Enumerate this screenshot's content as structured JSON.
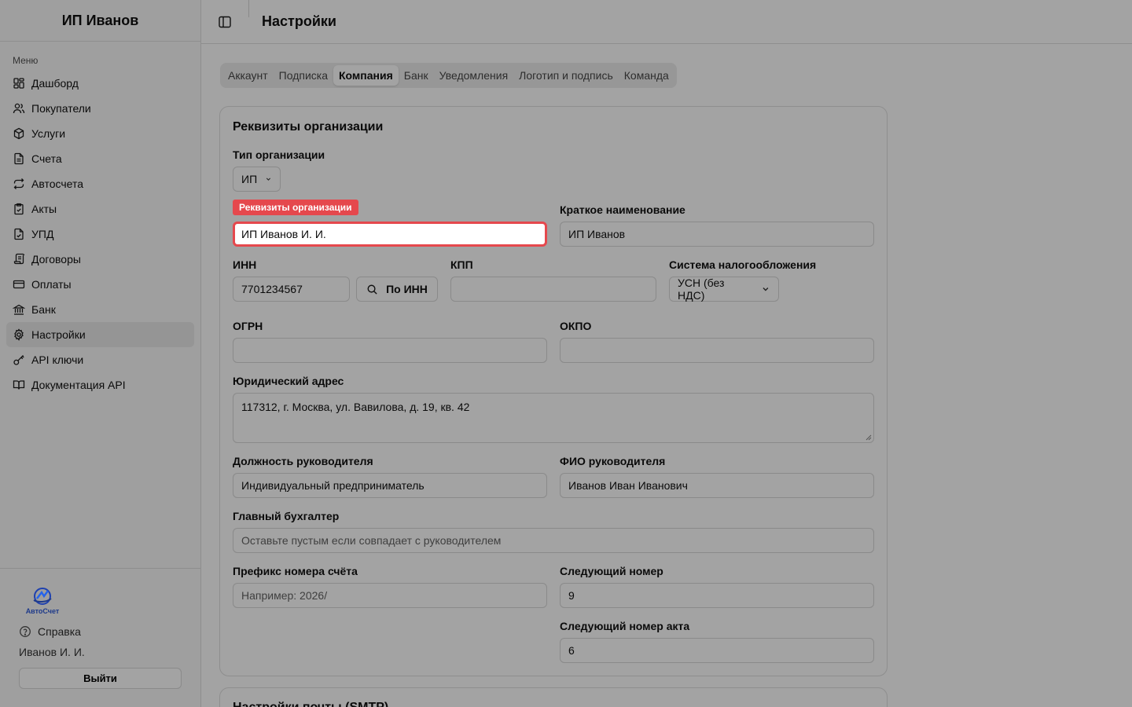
{
  "sidebar": {
    "company_name": "ИП Иванов",
    "menu_label": "Меню",
    "items": [
      {
        "label": "Дашборд",
        "icon": "dashboard-icon"
      },
      {
        "label": "Покупатели",
        "icon": "users-icon"
      },
      {
        "label": "Услуги",
        "icon": "package-icon"
      },
      {
        "label": "Счета",
        "icon": "file-icon"
      },
      {
        "label": "Автосчета",
        "icon": "repeat-icon"
      },
      {
        "label": "Акты",
        "icon": "clipboard-icon"
      },
      {
        "label": "УПД",
        "icon": "file-check-icon"
      },
      {
        "label": "Договоры",
        "icon": "scroll-icon"
      },
      {
        "label": "Оплаты",
        "icon": "credit-card-icon"
      },
      {
        "label": "Банк",
        "icon": "bank-icon"
      },
      {
        "label": "Настройки",
        "icon": "gear-icon",
        "active": true
      },
      {
        "label": "API ключи",
        "icon": "key-icon"
      },
      {
        "label": "Документация API",
        "icon": "book-icon"
      }
    ],
    "footer": {
      "logo_text": "АвтоСчет",
      "help_label": "Справка",
      "user_name": "Иванов И. И.",
      "logout_label": "Выйти"
    }
  },
  "header": {
    "title": "Настройки"
  },
  "tabs": [
    {
      "label": "Аккаунт"
    },
    {
      "label": "Подписка"
    },
    {
      "label": "Компания",
      "active": true
    },
    {
      "label": "Банк"
    },
    {
      "label": "Уведомления"
    },
    {
      "label": "Логотип и подпись"
    },
    {
      "label": "Команда"
    }
  ],
  "form": {
    "title": "Реквизиты организации",
    "org_type": {
      "label": "Тип организации",
      "value": "ИП"
    },
    "full_name": {
      "badge": "Реквизиты организации",
      "value": "ИП Иванов И. И."
    },
    "short_name": {
      "label": "Краткое наименование",
      "value": "ИП Иванов"
    },
    "inn": {
      "label": "ИНН",
      "value": "7701234567",
      "lookup_label": "По ИНН"
    },
    "kpp": {
      "label": "КПП",
      "value": ""
    },
    "tax_system": {
      "label": "Система налогообложения",
      "value": "УСН (без НДС)"
    },
    "ogrn": {
      "label": "ОГРН",
      "value": ""
    },
    "okpo": {
      "label": "ОКПО",
      "value": ""
    },
    "legal_address": {
      "label": "Юридический адрес",
      "value": "117312, г. Москва, ул. Вавилова, д. 19, кв. 42"
    },
    "director_position": {
      "label": "Должность руководителя",
      "value": "Индивидуальный предприниматель"
    },
    "director_name": {
      "label": "ФИО руководителя",
      "value": "Иванов Иван Иванович"
    },
    "chief_accountant": {
      "label": "Главный бухгалтер",
      "placeholder": "Оставьте пустым если совпадает с руководителем"
    },
    "invoice_prefix": {
      "label": "Префикс номера счёта",
      "placeholder": "Например: 2026/"
    },
    "next_number": {
      "label": "Следующий номер",
      "value": "9"
    },
    "next_act_number": {
      "label": "Следующий номер акта",
      "value": "6"
    }
  },
  "smtp_card": {
    "title": "Настройки почты (SMTP)"
  },
  "colors": {
    "accent_red": "#e5484d",
    "overlay_bg": "#a3a3a3"
  }
}
